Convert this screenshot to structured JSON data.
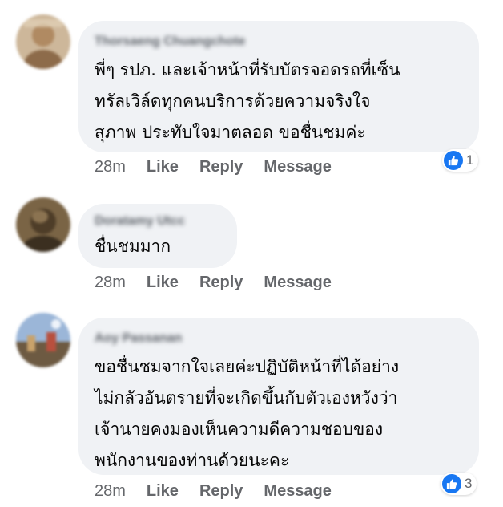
{
  "comments": [
    {
      "author": "Thorsaeng Chuangchote",
      "text": "พี่ๆ รปภ. และเจ้าหน้าที่รับบัตรจอดรถที่เซ็น\nทรัลเวิล์ดทุกคนบริการด้วยความจริงใจ\nสุภาพ ประทับใจมาตลอด ขอชื่นชมค่ะ",
      "time": "28m",
      "like_label": "Like",
      "reply_label": "Reply",
      "message_label": "Message",
      "reaction_count": "1",
      "reaction_icon": "like-thumb-icon",
      "avatar_color": "#b08a62"
    },
    {
      "author": "Doratamy Utcc",
      "text": "ชื่นชมมาก",
      "time": "28m",
      "like_label": "Like",
      "reply_label": "Reply",
      "message_label": "Message",
      "avatar_color": "#5a4a33"
    },
    {
      "author": "Aoy Passanan",
      "text": "ขอชื่นชมจากใจเลยค่ะปฏิบัติหน้าที่ได้อย่าง\nไม่กลัวอันตรายที่จะเกิดขึ้นกับตัวเองหวังว่า\nเจ้านายคงมองเห็นความดีความชอบของ\nพนักงานของท่านด้วยนะคะ",
      "time": "28m",
      "like_label": "Like",
      "reply_label": "Reply",
      "message_label": "Message",
      "reaction_count": "3",
      "reaction_icon": "like-thumb-icon",
      "avatar_color": "#6f8fb8"
    }
  ],
  "colors": {
    "bubble_bg": "#f0f2f5",
    "text": "#050505",
    "meta": "#65676b",
    "like_blue": "#1877f2"
  }
}
